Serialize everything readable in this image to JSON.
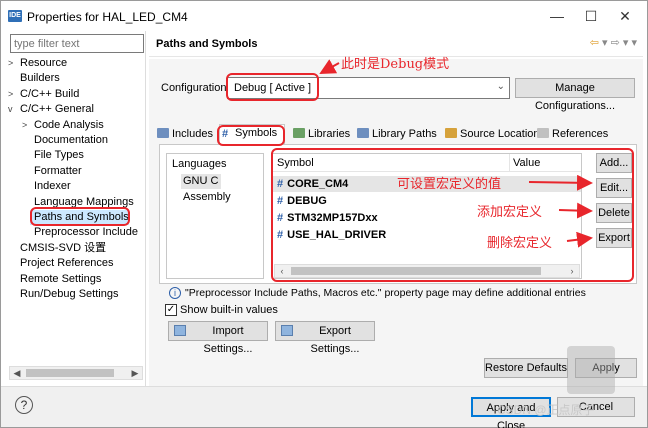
{
  "window": {
    "title": "Properties for HAL_LED_CM4",
    "app_icon": "IDE",
    "minimize": "—",
    "maximize": "☐",
    "close": "✕"
  },
  "left": {
    "filter_placeholder": "type filter text",
    "tree": [
      {
        "label": "Resource",
        "twisty": ">"
      },
      {
        "label": "Builders",
        "twisty": ""
      },
      {
        "label": "C/C++ Build",
        "twisty": ">"
      },
      {
        "label": "C/C++ General",
        "twisty": "v"
      },
      {
        "label": "Code Analysis",
        "twisty": ">"
      },
      {
        "label": "Documentation",
        "twisty": ""
      },
      {
        "label": "File Types",
        "twisty": ""
      },
      {
        "label": "Formatter",
        "twisty": ""
      },
      {
        "label": "Indexer",
        "twisty": ""
      },
      {
        "label": "Language Mappings",
        "twisty": ""
      },
      {
        "label": "Paths and Symbols",
        "twisty": ""
      },
      {
        "label": "Preprocessor Include",
        "twisty": ""
      },
      {
        "label": "CMSIS-SVD 设置",
        "twisty": ""
      },
      {
        "label": "Project References",
        "twisty": ""
      },
      {
        "label": "Remote Settings",
        "twisty": ""
      },
      {
        "label": "Run/Debug Settings",
        "twisty": ""
      }
    ]
  },
  "right": {
    "title": "Paths and Symbols",
    "config_label": "Configuration:",
    "config_value": "Debug  [ Active ]",
    "manage_btn": "Manage Configurations...",
    "tabs": [
      "Includes",
      "Symbols",
      "Libraries",
      "Library Paths",
      "Source Location",
      "References"
    ],
    "languages_header": "Languages",
    "languages": [
      "GNU C",
      "Assembly"
    ],
    "symbol_header": "Symbol",
    "value_header": "Value",
    "symbols": [
      "CORE_CM4",
      "DEBUG",
      "STM32MP157Dxx",
      "USE_HAL_DRIVER"
    ],
    "buttons": {
      "add": "Add...",
      "edit": "Edit...",
      "delete": "Delete",
      "export": "Export"
    },
    "info_text": "\"Preprocessor Include Paths, Macros etc.\" property page may define additional entries",
    "show_builtin": "Show built-in values",
    "import_btn": "Import Settings...",
    "export_btn": "Export Settings...",
    "restore_btn": "Restore Defaults",
    "apply_btn": "Apply"
  },
  "bottom": {
    "help": "?",
    "apply_close": "Apply and Close",
    "cancel": "Cancel"
  },
  "annotations": {
    "debug_mode": "此时是Debug模式",
    "edit_value": "可设置宏定义的值",
    "add_macro": "添加宏定义",
    "delete_macro": "删除宏定义"
  },
  "watermark": "CSDN @正点原子"
}
